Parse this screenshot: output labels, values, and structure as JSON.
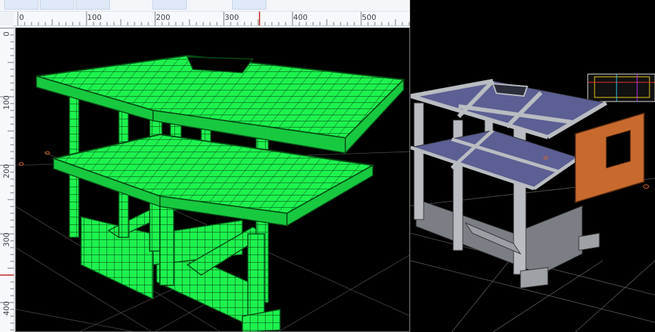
{
  "window": {
    "panes": [
      "structural-model-view",
      "rendered-model-view"
    ]
  },
  "rulers": {
    "horizontal": {
      "ticks": [
        "0",
        "100",
        "200",
        "300",
        "400",
        "500"
      ]
    },
    "vertical": {
      "ticks": [
        "0",
        "100",
        "200",
        "300",
        "400"
      ]
    }
  },
  "colors": {
    "mesh_green": "#1df24e",
    "mesh_line": "#064b15",
    "concrete": "#b9bcc1",
    "glass": "#5b5f93",
    "brick": "#c86a2e",
    "ruler_marker": "#c21a1a",
    "background": "#000000"
  },
  "icons": {
    "cursor_marker": "ruler-position-marker",
    "support_marker": "support-node-icon"
  }
}
